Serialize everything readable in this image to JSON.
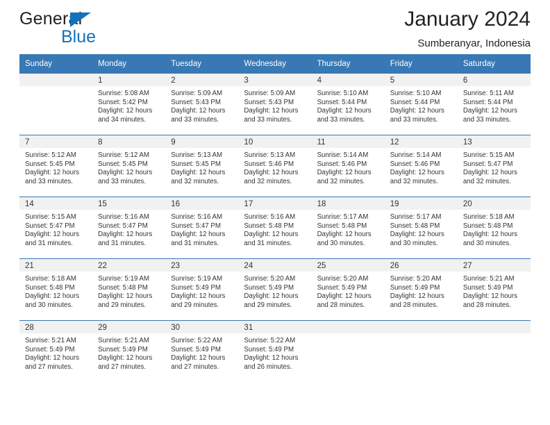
{
  "brand": {
    "name_top": "General",
    "name_bottom": "Blue",
    "accent_color": "#1272bb"
  },
  "header": {
    "title": "January 2024",
    "location": "Sumberanyar, Indonesia"
  },
  "theme": {
    "header_row_bg": "#3878b4",
    "daynum_bg": "#f1f1f1",
    "text": "#333333"
  },
  "calendar": {
    "weekday_headers": [
      "Sunday",
      "Monday",
      "Tuesday",
      "Wednesday",
      "Thursday",
      "Friday",
      "Saturday"
    ],
    "weeks": [
      [
        {
          "day": "",
          "sunrise": "",
          "sunset": "",
          "daylight_line1": "",
          "daylight_line2": ""
        },
        {
          "day": "1",
          "sunrise": "Sunrise: 5:08 AM",
          "sunset": "Sunset: 5:42 PM",
          "daylight_line1": "Daylight: 12 hours",
          "daylight_line2": "and 34 minutes."
        },
        {
          "day": "2",
          "sunrise": "Sunrise: 5:09 AM",
          "sunset": "Sunset: 5:43 PM",
          "daylight_line1": "Daylight: 12 hours",
          "daylight_line2": "and 33 minutes."
        },
        {
          "day": "3",
          "sunrise": "Sunrise: 5:09 AM",
          "sunset": "Sunset: 5:43 PM",
          "daylight_line1": "Daylight: 12 hours",
          "daylight_line2": "and 33 minutes."
        },
        {
          "day": "4",
          "sunrise": "Sunrise: 5:10 AM",
          "sunset": "Sunset: 5:44 PM",
          "daylight_line1": "Daylight: 12 hours",
          "daylight_line2": "and 33 minutes."
        },
        {
          "day": "5",
          "sunrise": "Sunrise: 5:10 AM",
          "sunset": "Sunset: 5:44 PM",
          "daylight_line1": "Daylight: 12 hours",
          "daylight_line2": "and 33 minutes."
        },
        {
          "day": "6",
          "sunrise": "Sunrise: 5:11 AM",
          "sunset": "Sunset: 5:44 PM",
          "daylight_line1": "Daylight: 12 hours",
          "daylight_line2": "and 33 minutes."
        }
      ],
      [
        {
          "day": "7",
          "sunrise": "Sunrise: 5:12 AM",
          "sunset": "Sunset: 5:45 PM",
          "daylight_line1": "Daylight: 12 hours",
          "daylight_line2": "and 33 minutes."
        },
        {
          "day": "8",
          "sunrise": "Sunrise: 5:12 AM",
          "sunset": "Sunset: 5:45 PM",
          "daylight_line1": "Daylight: 12 hours",
          "daylight_line2": "and 33 minutes."
        },
        {
          "day": "9",
          "sunrise": "Sunrise: 5:13 AM",
          "sunset": "Sunset: 5:45 PM",
          "daylight_line1": "Daylight: 12 hours",
          "daylight_line2": "and 32 minutes."
        },
        {
          "day": "10",
          "sunrise": "Sunrise: 5:13 AM",
          "sunset": "Sunset: 5:46 PM",
          "daylight_line1": "Daylight: 12 hours",
          "daylight_line2": "and 32 minutes."
        },
        {
          "day": "11",
          "sunrise": "Sunrise: 5:14 AM",
          "sunset": "Sunset: 5:46 PM",
          "daylight_line1": "Daylight: 12 hours",
          "daylight_line2": "and 32 minutes."
        },
        {
          "day": "12",
          "sunrise": "Sunrise: 5:14 AM",
          "sunset": "Sunset: 5:46 PM",
          "daylight_line1": "Daylight: 12 hours",
          "daylight_line2": "and 32 minutes."
        },
        {
          "day": "13",
          "sunrise": "Sunrise: 5:15 AM",
          "sunset": "Sunset: 5:47 PM",
          "daylight_line1": "Daylight: 12 hours",
          "daylight_line2": "and 32 minutes."
        }
      ],
      [
        {
          "day": "14",
          "sunrise": "Sunrise: 5:15 AM",
          "sunset": "Sunset: 5:47 PM",
          "daylight_line1": "Daylight: 12 hours",
          "daylight_line2": "and 31 minutes."
        },
        {
          "day": "15",
          "sunrise": "Sunrise: 5:16 AM",
          "sunset": "Sunset: 5:47 PM",
          "daylight_line1": "Daylight: 12 hours",
          "daylight_line2": "and 31 minutes."
        },
        {
          "day": "16",
          "sunrise": "Sunrise: 5:16 AM",
          "sunset": "Sunset: 5:47 PM",
          "daylight_line1": "Daylight: 12 hours",
          "daylight_line2": "and 31 minutes."
        },
        {
          "day": "17",
          "sunrise": "Sunrise: 5:16 AM",
          "sunset": "Sunset: 5:48 PM",
          "daylight_line1": "Daylight: 12 hours",
          "daylight_line2": "and 31 minutes."
        },
        {
          "day": "18",
          "sunrise": "Sunrise: 5:17 AM",
          "sunset": "Sunset: 5:48 PM",
          "daylight_line1": "Daylight: 12 hours",
          "daylight_line2": "and 30 minutes."
        },
        {
          "day": "19",
          "sunrise": "Sunrise: 5:17 AM",
          "sunset": "Sunset: 5:48 PM",
          "daylight_line1": "Daylight: 12 hours",
          "daylight_line2": "and 30 minutes."
        },
        {
          "day": "20",
          "sunrise": "Sunrise: 5:18 AM",
          "sunset": "Sunset: 5:48 PM",
          "daylight_line1": "Daylight: 12 hours",
          "daylight_line2": "and 30 minutes."
        }
      ],
      [
        {
          "day": "21",
          "sunrise": "Sunrise: 5:18 AM",
          "sunset": "Sunset: 5:48 PM",
          "daylight_line1": "Daylight: 12 hours",
          "daylight_line2": "and 30 minutes."
        },
        {
          "day": "22",
          "sunrise": "Sunrise: 5:19 AM",
          "sunset": "Sunset: 5:48 PM",
          "daylight_line1": "Daylight: 12 hours",
          "daylight_line2": "and 29 minutes."
        },
        {
          "day": "23",
          "sunrise": "Sunrise: 5:19 AM",
          "sunset": "Sunset: 5:49 PM",
          "daylight_line1": "Daylight: 12 hours",
          "daylight_line2": "and 29 minutes."
        },
        {
          "day": "24",
          "sunrise": "Sunrise: 5:20 AM",
          "sunset": "Sunset: 5:49 PM",
          "daylight_line1": "Daylight: 12 hours",
          "daylight_line2": "and 29 minutes."
        },
        {
          "day": "25",
          "sunrise": "Sunrise: 5:20 AM",
          "sunset": "Sunset: 5:49 PM",
          "daylight_line1": "Daylight: 12 hours",
          "daylight_line2": "and 28 minutes."
        },
        {
          "day": "26",
          "sunrise": "Sunrise: 5:20 AM",
          "sunset": "Sunset: 5:49 PM",
          "daylight_line1": "Daylight: 12 hours",
          "daylight_line2": "and 28 minutes."
        },
        {
          "day": "27",
          "sunrise": "Sunrise: 5:21 AM",
          "sunset": "Sunset: 5:49 PM",
          "daylight_line1": "Daylight: 12 hours",
          "daylight_line2": "and 28 minutes."
        }
      ],
      [
        {
          "day": "28",
          "sunrise": "Sunrise: 5:21 AM",
          "sunset": "Sunset: 5:49 PM",
          "daylight_line1": "Daylight: 12 hours",
          "daylight_line2": "and 27 minutes."
        },
        {
          "day": "29",
          "sunrise": "Sunrise: 5:21 AM",
          "sunset": "Sunset: 5:49 PM",
          "daylight_line1": "Daylight: 12 hours",
          "daylight_line2": "and 27 minutes."
        },
        {
          "day": "30",
          "sunrise": "Sunrise: 5:22 AM",
          "sunset": "Sunset: 5:49 PM",
          "daylight_line1": "Daylight: 12 hours",
          "daylight_line2": "and 27 minutes."
        },
        {
          "day": "31",
          "sunrise": "Sunrise: 5:22 AM",
          "sunset": "Sunset: 5:49 PM",
          "daylight_line1": "Daylight: 12 hours",
          "daylight_line2": "and 26 minutes."
        },
        {
          "day": "",
          "sunrise": "",
          "sunset": "",
          "daylight_line1": "",
          "daylight_line2": ""
        },
        {
          "day": "",
          "sunrise": "",
          "sunset": "",
          "daylight_line1": "",
          "daylight_line2": ""
        },
        {
          "day": "",
          "sunrise": "",
          "sunset": "",
          "daylight_line1": "",
          "daylight_line2": ""
        }
      ]
    ]
  }
}
